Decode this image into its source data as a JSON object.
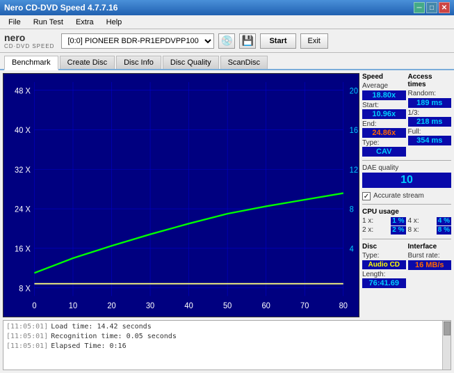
{
  "window": {
    "title": "Nero CD-DVD Speed 4.7.7.16",
    "min_btn": "─",
    "max_btn": "□",
    "close_btn": "✕"
  },
  "menu": {
    "items": [
      "File",
      "Run Test",
      "Extra",
      "Help"
    ]
  },
  "toolbar": {
    "logo_main": "nero",
    "logo_sub": "CD·DVD SPEED",
    "drive_label": "[0:0]  PIONEER BDR-PR1EPDVPP100 1.01",
    "start_label": "Start",
    "exit_label": "Exit"
  },
  "tabs": [
    {
      "label": "Benchmark",
      "active": true
    },
    {
      "label": "Create Disc",
      "active": false
    },
    {
      "label": "Disc Info",
      "active": false
    },
    {
      "label": "Disc Quality",
      "active": false
    },
    {
      "label": "ScanDisc",
      "active": false
    }
  ],
  "chart": {
    "y_axis_left": [
      "48 X",
      "40 X",
      "32 X",
      "24 X",
      "16 X",
      "8 X"
    ],
    "y_axis_right": [
      "20",
      "16",
      "12",
      "8",
      "4"
    ],
    "x_axis": [
      "0",
      "10",
      "20",
      "30",
      "40",
      "50",
      "60",
      "70",
      "80"
    ]
  },
  "speed_panel": {
    "title": "Speed",
    "average_label": "Average",
    "average_val": "18.80x",
    "start_label": "Start:",
    "start_val": "10.96x",
    "end_label": "End:",
    "end_val": "24.86x",
    "type_label": "Type:",
    "type_val": "CAV"
  },
  "access_panel": {
    "title": "Access times",
    "random_label": "Random:",
    "random_val": "189 ms",
    "onethird_label": "1/3:",
    "onethird_val": "218 ms",
    "full_label": "Full:",
    "full_val": "354 ms"
  },
  "dae_panel": {
    "label": "DAE quality",
    "value": "10"
  },
  "accurate_stream": {
    "label": "Accurate stream",
    "checked": true
  },
  "cpu_panel": {
    "title": "CPU usage",
    "values": [
      {
        "label": "1 x:",
        "val": "1 %"
      },
      {
        "label": "2 x:",
        "val": "2 %"
      },
      {
        "label": "4 x:",
        "val": "4 %"
      },
      {
        "label": "8 x:",
        "val": "8 %"
      }
    ]
  },
  "disc_panel": {
    "title": "Disc",
    "type_label": "Type:",
    "type_val": "Audio CD",
    "length_label": "Length:",
    "length_val": "76:41.69"
  },
  "interface_panel": {
    "title": "Interface",
    "burst_label": "Burst rate:",
    "burst_val": "16 MB/s"
  },
  "log": {
    "lines": [
      {
        "time": "[11:05:01]",
        "text": "Load time: 14.42 seconds"
      },
      {
        "time": "[11:05:01]",
        "text": "Recognition time: 0.05 seconds"
      },
      {
        "time": "[11:05:01]",
        "text": "Elapsed Time: 0:16"
      }
    ]
  }
}
